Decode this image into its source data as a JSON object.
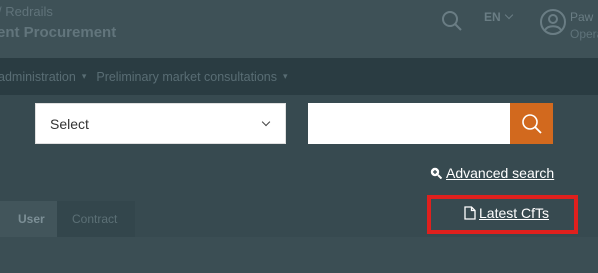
{
  "header": {
    "brand_line1": "/ Redrails",
    "brand_line2": "ent Procurement",
    "language": "EN",
    "user_name": "Paw",
    "user_role": "Operator /"
  },
  "nav": {
    "items": [
      {
        "label": "administration"
      },
      {
        "label": "Preliminary market consultations"
      }
    ]
  },
  "search": {
    "select_value": "Select",
    "input_value": "",
    "input_placeholder": ""
  },
  "links": {
    "advanced_search": "Advanced search",
    "latest_cfts": "Latest CfTs"
  },
  "tabs": [
    {
      "label": "User"
    },
    {
      "label": "Contract"
    }
  ],
  "colors": {
    "search_button": "#d2691e",
    "highlight": "#e0201d",
    "background": "#374a50"
  },
  "icons": {
    "search_button": "search-icon",
    "advanced_search": "zoom-plus-icon",
    "latest_cfts": "document-icon",
    "user": "user-circle-icon"
  }
}
